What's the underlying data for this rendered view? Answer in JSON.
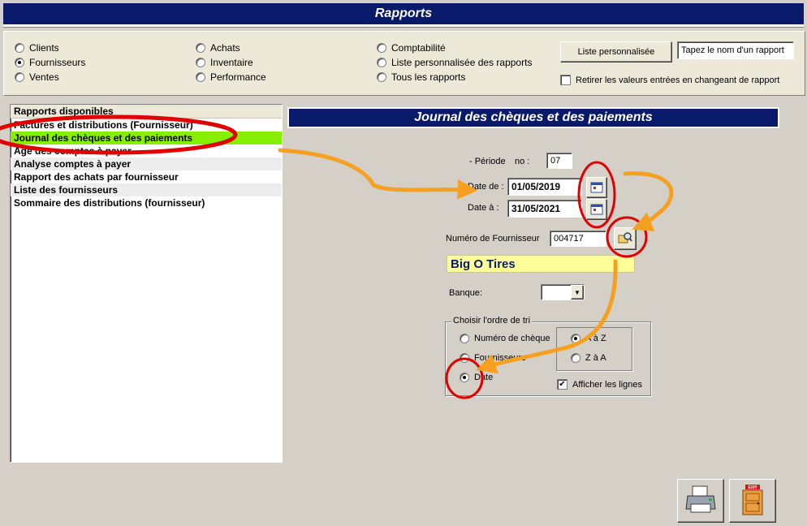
{
  "window": {
    "title": "Rapports"
  },
  "categories": {
    "col1": [
      {
        "label": "Clients",
        "checked": false
      },
      {
        "label": "Fournisseurs",
        "checked": true
      },
      {
        "label": "Ventes",
        "checked": false
      }
    ],
    "col2": [
      {
        "label": "Achats",
        "checked": false
      },
      {
        "label": "Inventaire",
        "checked": false
      },
      {
        "label": "Performance",
        "checked": false
      }
    ],
    "col3": [
      {
        "label": "Comptabilité",
        "checked": false
      },
      {
        "label": "Liste personnalisée des rapports",
        "checked": false
      },
      {
        "label": "Tous les rapports",
        "checked": false
      }
    ]
  },
  "custom": {
    "button_label": "Liste personnalisée",
    "search_value": "Tapez le nom d'un rapport",
    "reset_label": "Retirer les valeurs entrées en changeant de rapport"
  },
  "reports": {
    "header": "Rapports disponibles",
    "items": [
      "Factures et distributions (Fournisseur)",
      "Journal des chèques et des paiements",
      "Âge des comptes à payer",
      "Analyse comptes à payer",
      "Rapport des achats par fournisseur",
      "Liste des fournisseurs",
      "Sommaire des distributions (fournisseur)"
    ],
    "selected_index": 1
  },
  "detail": {
    "title": "Journal des chèques et des paiements",
    "period_label": "- Période",
    "no_label": "no :",
    "period_value": "07",
    "date_from_label": "Date de :",
    "date_from_value": "01/05/2019",
    "date_to_label": "Date à :",
    "date_to_value": "31/05/2021",
    "supplier_label": "Numéro de Fournisseur",
    "supplier_value": "004717",
    "supplier_name": "Big O Tires",
    "bank_label": "Banque:",
    "bank_value": "",
    "sort_legend": "Choisir l'ordre de tri",
    "sort_options": [
      {
        "label": "Numéro de chèque",
        "checked": false
      },
      {
        "label": "Fournisseurs",
        "checked": false
      },
      {
        "label": "Date",
        "checked": true
      }
    ],
    "order_options": [
      {
        "label": "A à Z",
        "checked": true
      },
      {
        "label": "Z à A",
        "checked": false
      }
    ],
    "show_lines_label": "Afficher les lignes",
    "show_lines_checked": true
  },
  "icons": {
    "calendar": "calendar-icon",
    "lookup": "lookup-icon",
    "print": "printer-icon",
    "exit": "exit-door-icon",
    "exit_sign": "EXIT"
  },
  "colors": {
    "title_bg": "#0a1a6b",
    "selection": "#84f000",
    "supplier_bg": "#ffff99",
    "annotation_red": "#e00000",
    "annotation_orange": "#f5a021"
  }
}
